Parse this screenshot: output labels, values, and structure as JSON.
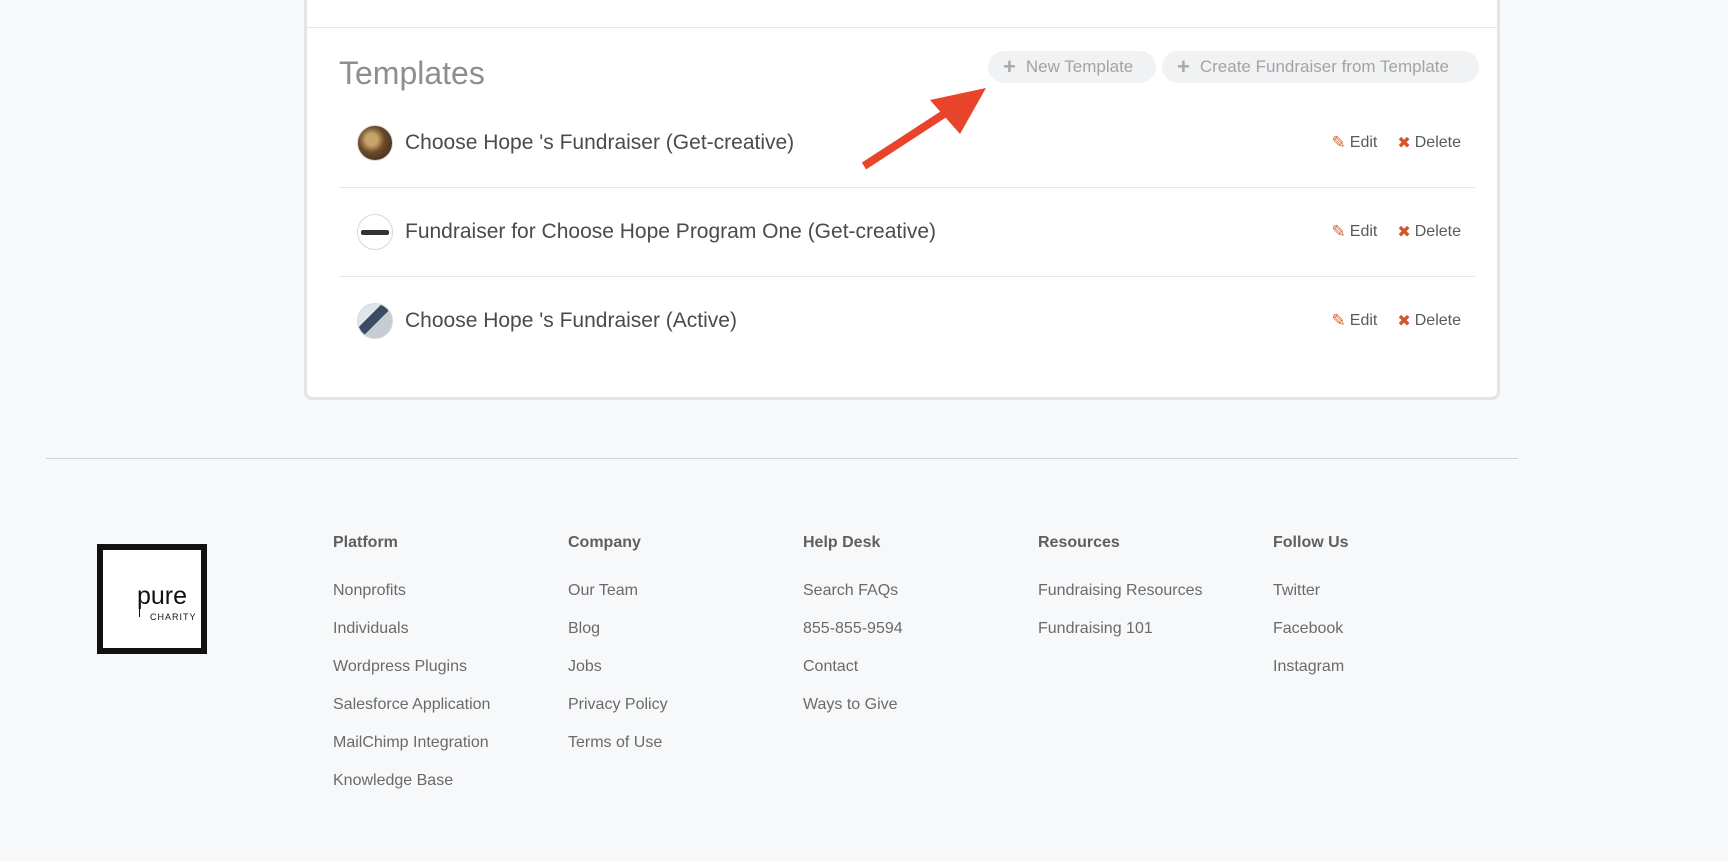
{
  "templates": {
    "title": "Templates",
    "new_template_label": "New Template",
    "create_from_template_label": "Create Fundraiser from Template",
    "edit_label": "Edit",
    "delete_label": "Delete",
    "rows": [
      {
        "title": "Choose Hope 's Fundraiser (Get-creative)"
      },
      {
        "title": "Fundraiser for Choose Hope Program One (Get-creative)"
      },
      {
        "title": "Choose Hope 's Fundraiser (Active)"
      }
    ]
  },
  "footer": {
    "logo": {
      "word": "pure",
      "sub": "CHARITY"
    },
    "columns": {
      "platform": {
        "heading": "Platform",
        "links": [
          "Nonprofits",
          "Individuals",
          "Wordpress Plugins",
          "Salesforce Application",
          "MailChimp Integration",
          "Knowledge Base"
        ]
      },
      "company": {
        "heading": "Company",
        "links": [
          "Our Team",
          "Blog",
          "Jobs",
          "Privacy Policy",
          "Terms of Use"
        ]
      },
      "help": {
        "heading": "Help Desk",
        "links": [
          "Search FAQs",
          "855-855-9594",
          "Contact",
          "Ways to Give"
        ]
      },
      "resources": {
        "heading": "Resources",
        "links": [
          "Fundraising Resources",
          "Fundraising 101"
        ]
      },
      "follow": {
        "heading": "Follow Us",
        "links": [
          "Twitter",
          "Facebook",
          "Instagram"
        ]
      }
    }
  },
  "colors": {
    "accent_orange": "#d2662a",
    "arrow_red": "#e8432b"
  },
  "icons": [
    "plus-icon",
    "pencil-icon",
    "x-icon",
    "arrow-annotation-icon"
  ]
}
